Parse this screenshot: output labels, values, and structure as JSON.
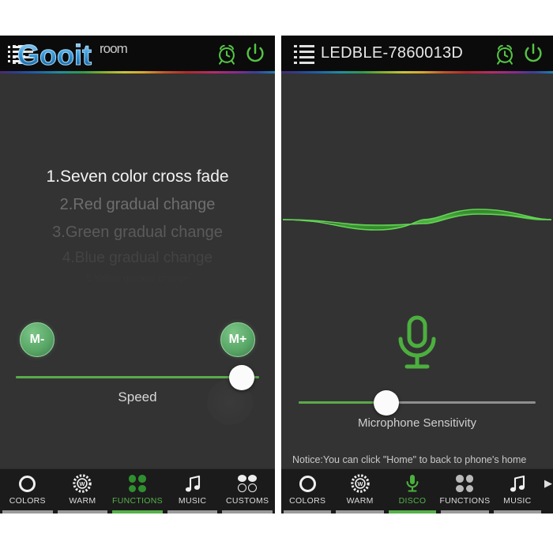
{
  "page": {
    "background_color": "#ffffff",
    "panel_background": "#333333",
    "header_background": "#0b0b0b",
    "accent_green": "#55b14a",
    "bright_green": "#5aaa4a"
  },
  "watermark": {
    "brand": "Gooit",
    "suffix": "room"
  },
  "left_panel": {
    "header": {
      "title": "",
      "menu_icon": "list-menu-icon",
      "alarm_icon": "alarm-clock-icon",
      "power_icon": "power-icon"
    },
    "function_list": {
      "items": [
        {
          "label": "1.Seven color cross fade",
          "selected": true
        },
        {
          "label": "2.Red  gradual change",
          "selected": false
        },
        {
          "label": "3.Green gradual change",
          "selected": false
        },
        {
          "label": "4.Blue gradual change",
          "selected": false
        },
        {
          "label": "5.Yellow gradual change",
          "selected": false
        }
      ]
    },
    "mode_minus_label": "M-",
    "mode_plus_label": "M+",
    "speed_slider": {
      "label": "Speed",
      "value_percent": 93,
      "fill_color": "#5aaa4a"
    },
    "tabs": [
      {
        "label": "COLORS",
        "icon": "color-ring-icon",
        "active": false
      },
      {
        "label": "WARM",
        "icon": "warm-gear-icon",
        "active": false
      },
      {
        "label": "FUNCTIONS",
        "icon": "four-dots-icon",
        "active": true
      },
      {
        "label": "MUSIC",
        "icon": "music-note-icon",
        "active": false
      },
      {
        "label": "CUSTOMS",
        "icon": "customs-circles-icon",
        "active": false
      }
    ]
  },
  "right_panel": {
    "header": {
      "title": "LEDBLE-7860013D",
      "menu_icon": "list-menu-icon",
      "alarm_icon": "alarm-clock-icon",
      "power_icon": "power-icon"
    },
    "waveform": {
      "name": "audio-waveform",
      "color": "#3fa832"
    },
    "mic_icon": "microphone-icon",
    "mic_slider": {
      "label": "Microphone Sensitivity",
      "value_percent": 37,
      "fill_color": "#5aaa4a"
    },
    "notice": "Notice:You can click \"Home\" to back to phone's home screen,and play music by any app.Then,your lighting will dance with music.",
    "tabs": [
      {
        "label": "COLORS",
        "icon": "color-ring-icon",
        "active": false
      },
      {
        "label": "WARM",
        "icon": "warm-gear-icon",
        "active": false
      },
      {
        "label": "DISCO",
        "icon": "microphone-icon",
        "active": true
      },
      {
        "label": "FUNCTIONS",
        "icon": "four-dots-icon",
        "active": false
      },
      {
        "label": "MUSIC",
        "icon": "music-note-icon",
        "active": false
      }
    ],
    "tab_scroll_arrow": "▶"
  }
}
